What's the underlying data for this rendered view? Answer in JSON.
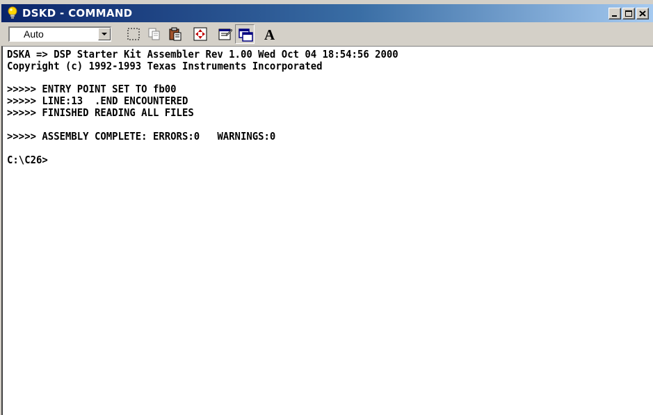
{
  "window": {
    "title": "DSKD - COMMAND",
    "icon": "lightbulb-icon",
    "controls": [
      "minimize",
      "maximize",
      "close"
    ]
  },
  "toolbar": {
    "font_size_value": "Auto",
    "tools": [
      {
        "name": "mark-icon"
      },
      {
        "name": "copy-icon"
      },
      {
        "name": "paste-icon"
      },
      {
        "name": "fullscreen-icon"
      },
      {
        "name": "properties-icon"
      },
      {
        "name": "background-icon"
      },
      {
        "name": "font-icon",
        "label": "A"
      }
    ]
  },
  "console": {
    "lines": [
      "DSKA => DSP Starter Kit Assembler Rev 1.00 Wed Oct 04 18:54:56 2000",
      "Copyright (c) 1992-1993 Texas Instruments Incorporated",
      ">>>>> ENTRY POINT SET TO fb00",
      ">>>>> LINE:13  .END ENCOUNTERED",
      ">>>>> FINISHED READING ALL FILES",
      ">>>>> ASSEMBLY COMPLETE: ERRORS:0   WARNINGS:0",
      "C:\\C26>"
    ]
  },
  "colors": {
    "titlebar_start": "#0a246a",
    "titlebar_end": "#a6caf0",
    "chrome": "#d4d0c8",
    "console_bg": "#ffffff",
    "console_text": "#000000"
  }
}
